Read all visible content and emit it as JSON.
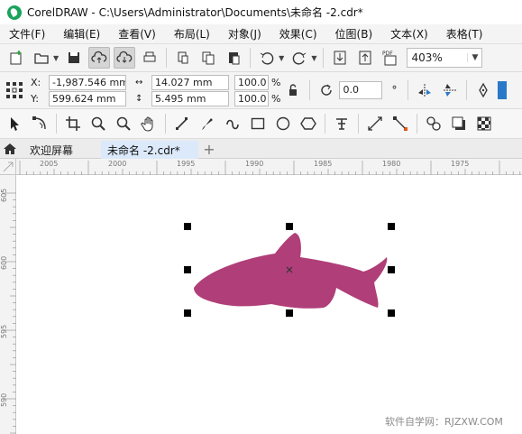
{
  "window": {
    "title": "CorelDRAW - C:\\Users\\Administrator\\Documents\\未命名 -2.cdr*"
  },
  "menu": [
    "文件(F)",
    "编辑(E)",
    "查看(V)",
    "布局(L)",
    "对象(J)",
    "效果(C)",
    "位图(B)",
    "文本(X)",
    "表格(T)"
  ],
  "toolbar": {
    "zoom": "403%",
    "pdf_label": "PDF"
  },
  "props": {
    "x_label": "X:",
    "x": "-1,987.546 mm",
    "y_label": "Y:",
    "y": "599.624 mm",
    "w": "14.027 mm",
    "h": "5.495 mm",
    "sx": "100.0",
    "sy": "100.0",
    "pct": "%",
    "rotation": "0.0",
    "rotation_unit": "°"
  },
  "tabs": {
    "welcome": "欢迎屏幕",
    "document": "未命名 -2.cdr*",
    "add": "+"
  },
  "rulers": {
    "h_ticks": [
      "2005",
      "2000",
      "1995",
      "1990",
      "1985",
      "1980",
      "1975"
    ],
    "v_ticks": [
      "605",
      "600",
      "595",
      "590"
    ],
    "unit": "毫米"
  },
  "shape": {
    "fill": "#b03e78",
    "name": "fish"
  },
  "colors": {
    "accent": "#19a35a",
    "selected_tab": "#dbe9fb"
  },
  "watermark": "软件自学网：RJZXW.COM"
}
